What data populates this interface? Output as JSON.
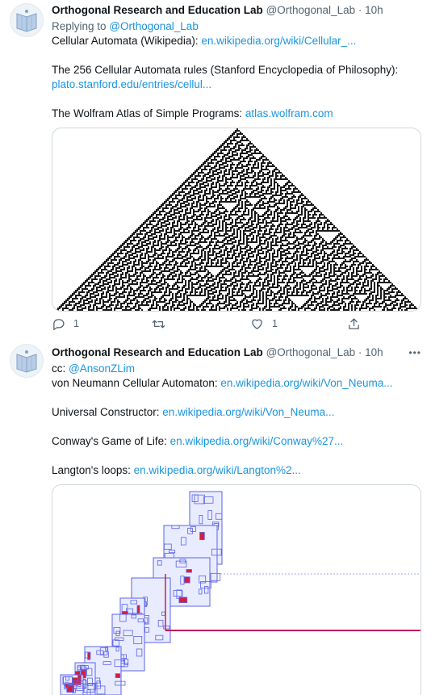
{
  "tweets": [
    {
      "author_name": "Orthogonal Research and Education Lab",
      "author_handle": "@Orthogonal_Lab",
      "time": "10h",
      "separator": "·",
      "reply_prefix": "Replying to ",
      "reply_handle": "@Orthogonal_Lab",
      "lines": [
        {
          "text": "Cellular Automata (Wikipedia): ",
          "link": "en.wikipedia.org/wiki/Cellular_..."
        },
        {
          "text": "",
          "link": ""
        },
        {
          "text": "The 256 Cellular Automata rules (Stanford Encyclopedia of Philosophy):",
          "link": ""
        },
        {
          "text": "",
          "link": "plato.stanford.edu/entries/cellul..."
        },
        {
          "text": "",
          "link": ""
        },
        {
          "text": "The Wolfram Atlas of Simple Programs: ",
          "link": "atlas.wolfram.com"
        }
      ],
      "media": "Rule 30 cellular automaton triangle pattern",
      "actions": {
        "reply_count": "1",
        "retweet_count": "",
        "like_count": "1",
        "share": ""
      }
    },
    {
      "author_name": "Orthogonal Research and Education Lab",
      "author_handle": "@Orthogonal_Lab",
      "time": "10h",
      "separator": "·",
      "more": "•••",
      "cc_prefix": "cc: ",
      "cc_handle": "@AnsonZLim",
      "lines": [
        {
          "text": "von Neumann Cellular Automaton: ",
          "link": "en.wikipedia.org/wiki/Von_Neuma..."
        },
        {
          "text": "",
          "link": ""
        },
        {
          "text": "Universal Constructor: ",
          "link": "en.wikipedia.org/wiki/Von_Neuma..."
        },
        {
          "text": "",
          "link": ""
        },
        {
          "text": "Conway's Game of Life: ",
          "link": "en.wikipedia.org/wiki/Conway%27..."
        },
        {
          "text": "",
          "link": ""
        },
        {
          "text": "Langton's loops: ",
          "link": "en.wikipedia.org/wiki/Langton%2..."
        }
      ],
      "media": "von Neumann universal constructor diagram"
    }
  ],
  "colors": {
    "link": "#1b95e0",
    "muted": "#536471",
    "constructor_blue": "#5b63e8",
    "constructor_red": "#d81b3a"
  }
}
